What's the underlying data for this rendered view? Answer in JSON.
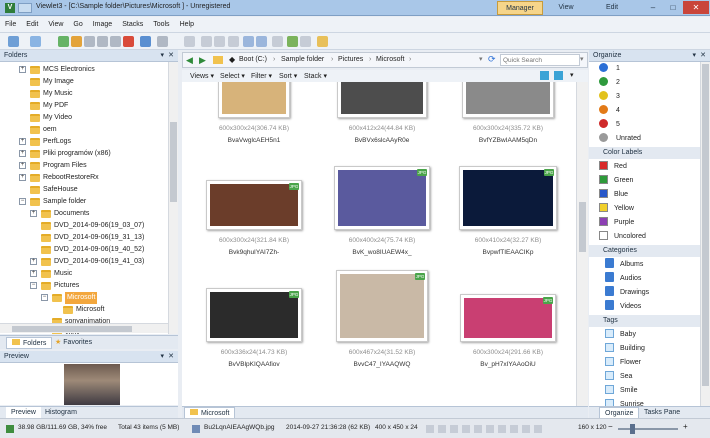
{
  "window": {
    "title": "Viewlet3 - [C:\\Sample folder\\Pictures\\Microsoft ] - Unregistered",
    "modes": [
      "Manager",
      "View",
      "Edit"
    ],
    "active_mode": "Manager",
    "controls": {
      "minimize": "–",
      "maximize": "□",
      "close": "✕"
    }
  },
  "menu": [
    "File",
    "Edit",
    "View",
    "Go",
    "Image",
    "Stacks",
    "Tools",
    "Help"
  ],
  "folders_panel": {
    "title": "Folders",
    "items": [
      {
        "label": "MCS Electronics",
        "level": 2,
        "expander": "+"
      },
      {
        "label": "My Image",
        "level": 2,
        "expander": ""
      },
      {
        "label": "My Music",
        "level": 2,
        "expander": ""
      },
      {
        "label": "My PDF",
        "level": 2,
        "expander": ""
      },
      {
        "label": "My Video",
        "level": 2,
        "expander": ""
      },
      {
        "label": "oem",
        "level": 2,
        "expander": ""
      },
      {
        "label": "PerfLogs",
        "level": 2,
        "expander": "+"
      },
      {
        "label": "Pliki programów (x86)",
        "level": 2,
        "expander": "+"
      },
      {
        "label": "Program Files",
        "level": 2,
        "expander": "+"
      },
      {
        "label": "RebootRestoreRx",
        "level": 2,
        "expander": "+"
      },
      {
        "label": "SafeHouse",
        "level": 2,
        "expander": ""
      },
      {
        "label": "Sample folder",
        "level": 2,
        "expander": "−"
      },
      {
        "label": "Documents",
        "level": 3,
        "expander": "+"
      },
      {
        "label": "DVD_2014-09-06(19_03_07)",
        "level": 3,
        "expander": ""
      },
      {
        "label": "DVD_2014-09-06(19_31_13)",
        "level": 3,
        "expander": ""
      },
      {
        "label": "DVD_2014-09-06(19_40_52)",
        "level": 3,
        "expander": ""
      },
      {
        "label": "DVD_2014-09-06(19_41_03)",
        "level": 3,
        "expander": "+"
      },
      {
        "label": "Music",
        "level": 3,
        "expander": "+"
      },
      {
        "label": "Pictures",
        "level": 3,
        "expander": "−"
      },
      {
        "label": "Microsoft",
        "level": 4,
        "expander": "−",
        "selected": true
      },
      {
        "label": "Microsoft",
        "level": 5,
        "expander": ""
      },
      {
        "label": "sonyanimation",
        "level": 4,
        "expander": ""
      },
      {
        "label": "xbox",
        "level": 4,
        "expander": ""
      }
    ],
    "tabs": [
      "Folders",
      "Favorites"
    ]
  },
  "preview_panel": {
    "title": "Preview",
    "tabs": [
      "Preview",
      "Histogram"
    ]
  },
  "address": {
    "crumbs": [
      "Boot (C:)",
      "Sample folder",
      "Pictures",
      "Microsoft"
    ],
    "search_placeholder": "Quick Search"
  },
  "viewbar": [
    "Views",
    "Select",
    "Filter",
    "Sort",
    "Stack"
  ],
  "thumbnails": [
    {
      "meta": "600x300x24(306.74 KB)",
      "name": "BvaVwglcAEH5n1",
      "color": "#d7b37a",
      "badge": false
    },
    {
      "meta": "600x412x24(44.84 KB)",
      "name": "BvBVx6slcAAyR0e",
      "color": "#4d4d4d",
      "badge": false
    },
    {
      "meta": "600x300x24(335.72 KB)",
      "name": "BvfYZBwIAAM5qDn",
      "color": "#8a8a8a",
      "badge": false
    },
    {
      "meta": "600x300x24(321.84 KB)",
      "name": "Bvk9qhuIYAI7Zh-",
      "color": "#6b3d2a",
      "badge": true
    },
    {
      "meta": "600x400x24(75.74 KB)",
      "name": "BvK_wo8IUAEW4x_",
      "color": "#5a5a9e",
      "badge": true
    },
    {
      "meta": "600x410x24(32.27 KB)",
      "name": "BvpwfTIEAACIKp",
      "color": "#0b1a3a",
      "badge": true
    },
    {
      "meta": "600x336x24(14.73 KB)",
      "name": "BvVBlpKIQAAfiov",
      "color": "#2b2b2b",
      "badge": true
    },
    {
      "meta": "600x467x24(31.52 KB)",
      "name": "BvvC47_IYAAQWQ",
      "color": "#c9b9a6",
      "badge": true
    },
    {
      "meta": "600x300x24(291.66 KB)",
      "name": "Bv_pH7xIYAAoOiU",
      "color": "#c93f72",
      "badge": true
    }
  ],
  "center_tab": "Microsoft",
  "organize_panel": {
    "title": "Organize",
    "ratings": [
      {
        "label": "1",
        "color": "#2b6fd6"
      },
      {
        "label": "2",
        "color": "#2f9a3d"
      },
      {
        "label": "3",
        "color": "#e2c21c"
      },
      {
        "label": "4",
        "color": "#e27a18"
      },
      {
        "label": "5",
        "color": "#cf2a2a"
      },
      {
        "label": "Unrated",
        "color": "#9a9a9a"
      }
    ],
    "color_labels_title": "Color Labels",
    "color_labels": [
      {
        "label": "Red",
        "color": "#d82a2a"
      },
      {
        "label": "Green",
        "color": "#2e9a3a"
      },
      {
        "label": "Blue",
        "color": "#2857c9"
      },
      {
        "label": "Yellow",
        "color": "#f1d02b"
      },
      {
        "label": "Purple",
        "color": "#8c3fb3"
      },
      {
        "label": "Uncolored",
        "color": "#ffffff"
      }
    ],
    "categories_title": "Categories",
    "categories": [
      "Albums",
      "Audios",
      "Drawings",
      "Videos"
    ],
    "tags_title": "Tags",
    "tags": [
      "Baby",
      "Building",
      "Flower",
      "Sea",
      "Smile",
      "Sunrise"
    ],
    "tabs": [
      "Organize",
      "Tasks Pane"
    ]
  },
  "statusbar": {
    "disk": "38.98 GB/111.69 GB, 34% free",
    "total": "Total 43 items (5 MB)",
    "file": "Bu2LqnAIEAAgWQb.jpg",
    "date": "2014-09-27 21:36:28 (62 KB)",
    "dims": "400 x 450 x 24",
    "thumb": "160 x 120"
  }
}
